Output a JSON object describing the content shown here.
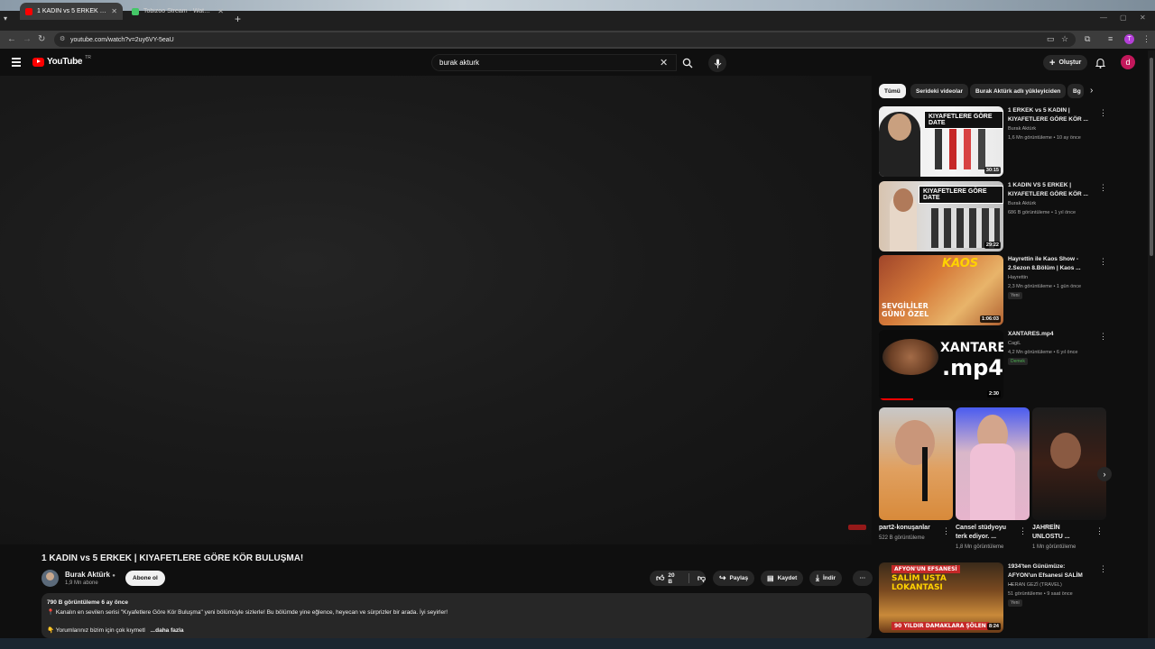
{
  "browser": {
    "tabs": [
      {
        "title": "1 KADIN vs 5 ERKEK | KIYAFETLE",
        "active": true,
        "favicon_color": "#ff0000"
      },
      {
        "title": "Tobizoo Stream - Watch Live o",
        "active": false,
        "favicon_color": "#44c767"
      }
    ],
    "url": "youtube.com/watch?v=2uy6VY-5eaU"
  },
  "header": {
    "logo": "YouTube",
    "logo_region": "TR",
    "search_value": "burak akturk",
    "create_label": "Oluştur",
    "avatar_letter": "d"
  },
  "video": {
    "title": "1 KADIN vs 5 ERKEK | KIYAFETLERE GÖRE KÖR BULUŞMA!",
    "channel": "Burak Aktürk",
    "subscribers": "1,9 Mn abone",
    "subscribe_label": "Abone ol",
    "likes": "20 B",
    "share_label": "Paylaş",
    "save_label": "Kaydet",
    "download_label": "İndir",
    "desc_meta": "790 B görüntüleme  6 ay önce",
    "desc_line1": "📍 Kanalın en sevilen serisi \"Kıyafetlere Göre Kör Buluşma\" yeni bölümüyle sizlerle! Bu bölümde yine eğlence, heyecan ve sürprizler bir arada. İyi seyirler!",
    "desc_line2": "👇 Yorumlarınız bizim için çok kıymetl",
    "desc_more": "...daha fazla"
  },
  "chips": [
    "Tümü",
    "Serideki videolar",
    "Burak Aktürk adlı yükleyiciden",
    "Bg"
  ],
  "recommendations": [
    {
      "title": "1 ERKEK vs 5 KADIN | KIYAFETLERE GÖRE KÖR ...",
      "channel": "Burak Aktürk",
      "meta": "1,6 Mn görüntüleme • 10 ay önce",
      "duration": "30:15",
      "banner": "KIYAFETLERE GÖRE DATE"
    },
    {
      "title": "1 KADIN VS 5 ERKEK | KIYAFETLERE GÖRE KÖR ...",
      "channel": "Burak Aktürk",
      "meta": "686 B görüntüleme • 1 yıl önce",
      "duration": "29:22",
      "banner": "KIYAFETLERE GÖRE DATE"
    },
    {
      "title": "Hayrettin ile Kaos Show - 2.Sezon 8.Bölüm | Kaos ...",
      "channel": "Hayrettin",
      "meta": "2,3 Mn görüntüleme • 1 gün önce",
      "badge": "Yeni",
      "duration": "1:06:03",
      "thumb_top": "KAOS",
      "thumb_bottom": "SEVGİLİLER GÜNÜ ÖZEL"
    },
    {
      "title": "XANTARES.mp4",
      "channel": "CagiL",
      "meta": "4,2 Mn görüntüleme • 6 yıl önce",
      "badge": "Demek",
      "duration": "2:30",
      "thumb_top": "XANTARES",
      "thumb_bottom": ".mp4"
    },
    {
      "title": "1934'ten Günümüze: AFYON'un Efsanesi SALİM ...",
      "channel": "HERAN GEZİ (TRAVEL)",
      "meta": "51 görüntüleme • 9 saat önce",
      "badge": "Yeni",
      "duration": "8:24",
      "thumb_top": "AFYON'UN EFSANESİ",
      "thumb_mid": "SALİM USTA LOKANTASI",
      "thumb_bottom": "90 YILDIR DAMAKLARA ŞÖLEN"
    }
  ],
  "shorts": [
    {
      "title": "part2-konuşanlar",
      "views": "522 B görüntüleme"
    },
    {
      "title": "Cansel stüdyoyu terk ediyor. ...",
      "views": "1,8 Mn görüntüleme"
    },
    {
      "title": "JAHREİN UNLOSTU ...",
      "views": "1 Mn görüntüleme"
    }
  ]
}
